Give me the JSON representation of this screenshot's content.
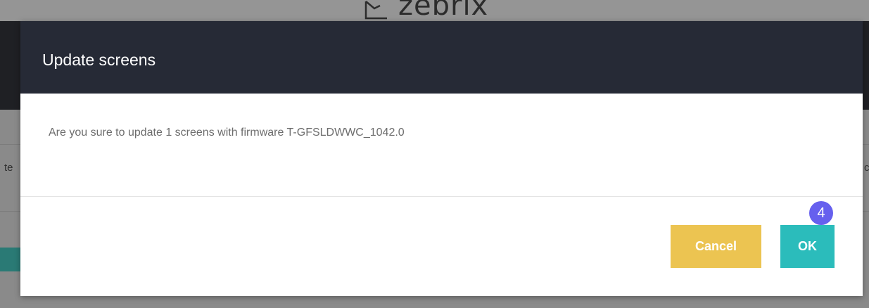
{
  "background": {
    "logo_text": "zebrix",
    "left_partial_text": "te",
    "right_partial_text": "c"
  },
  "modal": {
    "title": "Update screens",
    "message": "Are you sure to update 1 screens with firmware T-GFSLDWWC_1042.0",
    "cancel_label": "Cancel",
    "ok_label": "OK",
    "step_badge": "4"
  },
  "colors": {
    "header_bg": "#262a36",
    "cancel_bg": "#ecc451",
    "ok_bg": "#2bbcbb",
    "badge_bg": "#6660ee"
  }
}
